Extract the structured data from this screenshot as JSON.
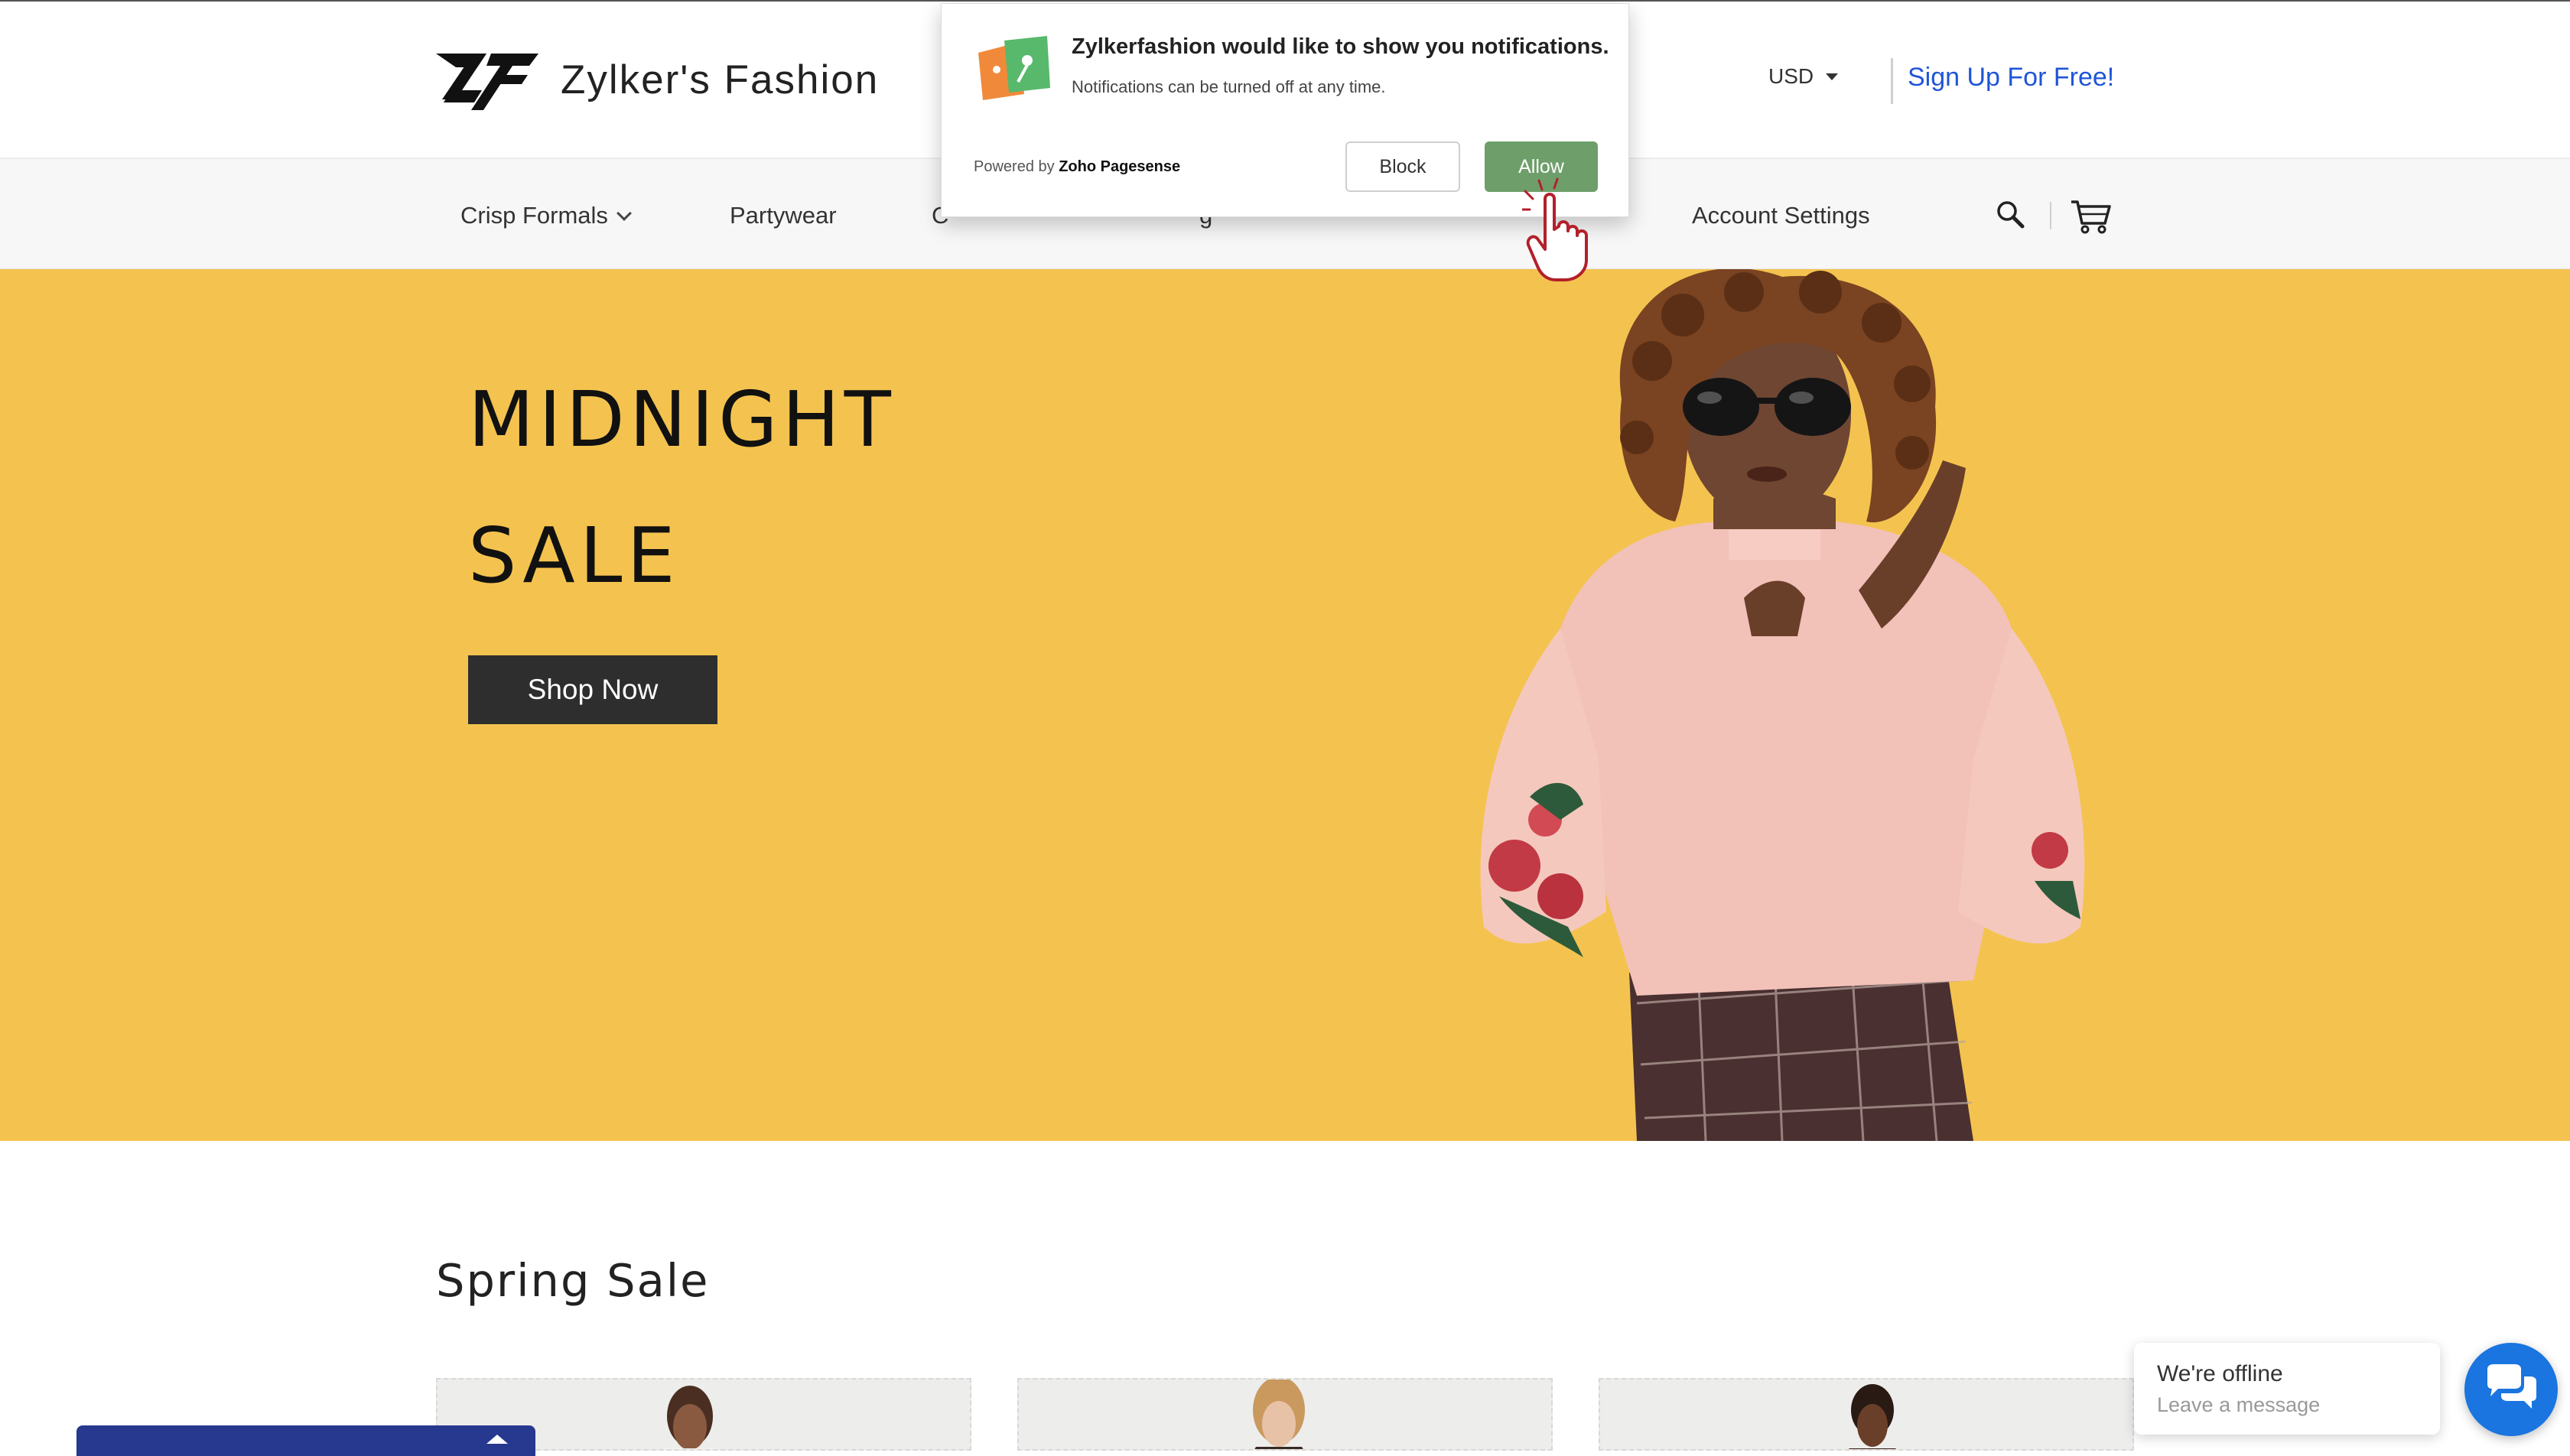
{
  "header": {
    "brand_name": "Zylker's Fashion",
    "currency": "USD",
    "signup_label": "Sign Up For Free!"
  },
  "nav": {
    "items": [
      {
        "label": "Crisp Formals",
        "has_dropdown": true
      },
      {
        "label": "Partywear"
      },
      {
        "label": "C"
      },
      {
        "label": "g"
      },
      {
        "label": "Account Settings"
      }
    ],
    "icons": [
      "search-icon",
      "cart-icon"
    ]
  },
  "notification": {
    "title": "Zylkerfashion would like to show you notifications.",
    "subtitle": "Notifications can be turned off at any time.",
    "powered_prefix": "Powered by",
    "powered_brand": "Zoho Pagesense",
    "block_label": "Block",
    "allow_label": "Allow"
  },
  "hero": {
    "title_line_1": "MIDNIGHT",
    "title_line_2": "SALE",
    "cta_label": "Shop Now",
    "background_color": "#f4c34f"
  },
  "section": {
    "title": "Spring Sale"
  },
  "chat": {
    "status": "We're offline",
    "prompt": "Leave a message",
    "button_color": "#1a75e0"
  },
  "colors": {
    "link": "#1f55d6",
    "allow": "#6e9f6b",
    "cta": "#2e2e2e",
    "bottom_bar": "#27388f"
  }
}
